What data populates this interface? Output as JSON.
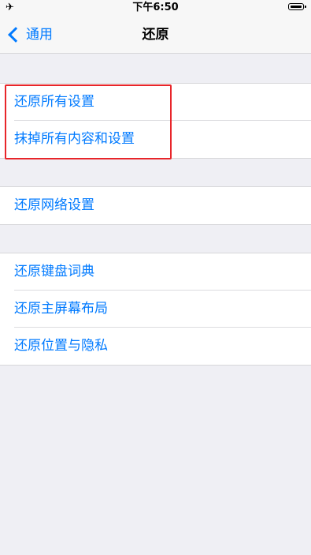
{
  "status_bar": {
    "airplane_icon": "✈",
    "time": "下午6:50"
  },
  "nav": {
    "back_label": "通用",
    "title": "还原"
  },
  "groups": [
    {
      "items": [
        {
          "label": "还原所有设置"
        },
        {
          "label": "抹掉所有内容和设置"
        }
      ]
    },
    {
      "items": [
        {
          "label": "还原网络设置"
        }
      ]
    },
    {
      "items": [
        {
          "label": "还原键盘词典"
        },
        {
          "label": "还原主屏幕布局"
        },
        {
          "label": "还原位置与隐私"
        }
      ]
    }
  ],
  "colors": {
    "accent": "#007aff",
    "background": "#efeff4",
    "highlight": "#e8252a"
  }
}
